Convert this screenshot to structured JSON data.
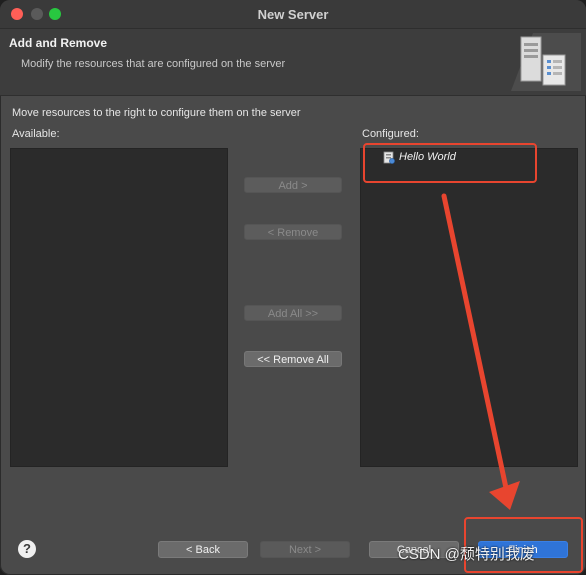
{
  "window": {
    "title": "New Server"
  },
  "header": {
    "title": "Add and Remove",
    "subtitle": "Modify the resources that are configured on the server"
  },
  "main": {
    "instruction": "Move resources to the right to configure them on the server",
    "available_label": "Available:",
    "configured_label": "Configured:",
    "available_items": [],
    "configured_items": [
      {
        "label": "Hello World",
        "icon": "web-project-icon"
      }
    ]
  },
  "buttons": {
    "add": "Add >",
    "remove": "< Remove",
    "add_all": "Add All >>",
    "remove_all": "<< Remove All"
  },
  "footer": {
    "help_glyph": "?",
    "back": "< Back",
    "next": "Next >",
    "cancel": "Cancel",
    "finish": "Finish"
  },
  "watermark": "CSDN @颓特别我废",
  "colors": {
    "highlight": "#e8452f",
    "accent": "#2f74d8"
  }
}
